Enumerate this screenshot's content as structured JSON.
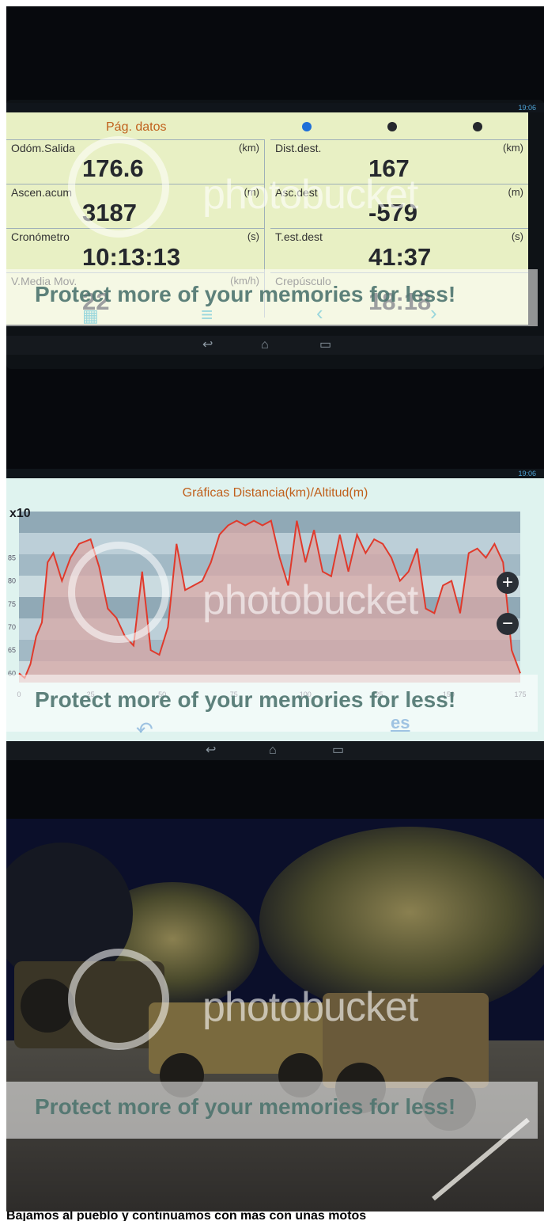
{
  "screen1": {
    "title": "Pág. datos",
    "time": "19:06",
    "cells": [
      {
        "label": "Odóm.Salida",
        "unit": "(km)",
        "value": "176.6"
      },
      {
        "label": "Dist.dest.",
        "unit": "(km)",
        "value": "167"
      },
      {
        "label": "Ascen.acum",
        "unit": "(m)",
        "value": "3187"
      },
      {
        "label": "Asc.dest",
        "unit": "(m)",
        "value": "-579"
      },
      {
        "label": "Cronómetro",
        "unit": "(s)",
        "value": "10:13:13"
      },
      {
        "label": "T.est.dest",
        "unit": "(s)",
        "value": "41:37"
      },
      {
        "label": "V.Media Mov.",
        "unit": "(km/h)",
        "value": "22"
      },
      {
        "label": "Crepúsculo",
        "unit": "",
        "value": "18:18"
      }
    ]
  },
  "screen2": {
    "time": "19:06",
    "nav_label": "es"
  },
  "watermark": {
    "brand": "photobucket",
    "banner": "Protect more of your memories for less!"
  },
  "caption": "Bajamos al pueblo y continuamos con mas con unas motos",
  "chart_data": {
    "type": "area",
    "title": "Gráficas Distancia(km)/Altitud(m)",
    "scale_label": "x10",
    "xlabel": "Distancia(km)",
    "ylabel": "Altitud(m)",
    "xlim": [
      0,
      175
    ],
    "x_ticks": [
      "0",
      "25",
      "50",
      "75",
      "100",
      "125",
      "150",
      "175"
    ],
    "y_ticks": [
      "60",
      "65",
      "70",
      "75",
      "80",
      "85"
    ],
    "x": [
      0,
      2,
      4,
      6,
      8,
      10,
      12,
      15,
      18,
      21,
      25,
      28,
      31,
      34,
      37,
      40,
      43,
      46,
      49,
      52,
      55,
      58,
      61,
      64,
      67,
      70,
      73,
      76,
      79,
      82,
      85,
      88,
      91,
      94,
      97,
      100,
      103,
      106,
      109,
      112,
      115,
      118,
      121,
      124,
      127,
      130,
      133,
      136,
      139,
      142,
      145,
      148,
      151,
      154,
      157,
      160,
      163,
      166,
      169,
      172,
      175
    ],
    "y": [
      60,
      59,
      62,
      68,
      71,
      84,
      86,
      80,
      85,
      88,
      89,
      83,
      74,
      72,
      68,
      66,
      82,
      65,
      64,
      70,
      88,
      78,
      79,
      80,
      84,
      90,
      92,
      93,
      92,
      93,
      92,
      93,
      85,
      79,
      93,
      84,
      91,
      82,
      81,
      90,
      82,
      90,
      86,
      89,
      88,
      85,
      80,
      82,
      87,
      74,
      73,
      79,
      80,
      73,
      86,
      87,
      85,
      88,
      84,
      65,
      60
    ]
  },
  "colors": {
    "screen_bg": "#e8f0c4",
    "accent_blue": "#1f6fd8",
    "title_orange": "#c0601c",
    "series_red": "#e03a2c",
    "navbar_bg": "#15191e"
  }
}
